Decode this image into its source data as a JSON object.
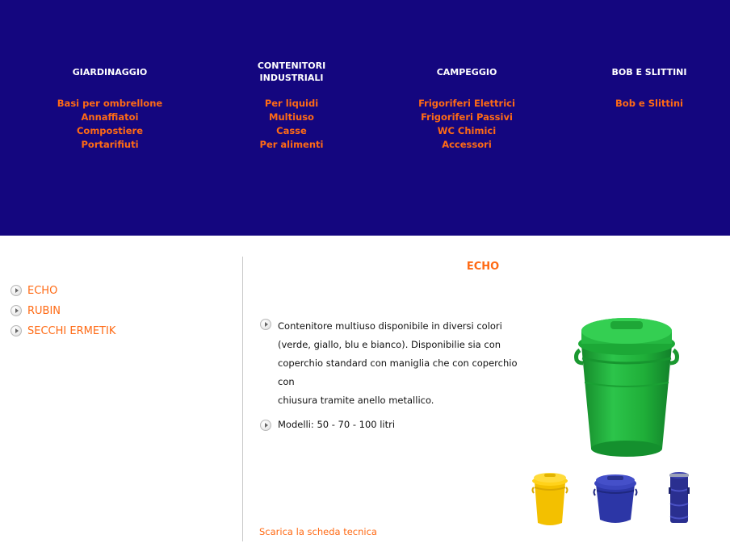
{
  "nav": [
    {
      "title": "GIARDINAGGIO",
      "links": [
        "Basi per ombrellone",
        "Annaffiatoi",
        "Compostiere",
        "Portarifiuti"
      ]
    },
    {
      "title": "CONTENITORI INDUSTRIALI",
      "title_lines": [
        "CONTENITORI",
        "INDUSTRIALI"
      ],
      "links": [
        "Per liquidi",
        "Multiuso",
        "Casse",
        "Per alimenti"
      ]
    },
    {
      "title": "CAMPEGGIO",
      "links": [
        "Frigoriferi Elettrici",
        "Frigoriferi Passivi",
        "WC Chimici",
        "Accessori"
      ]
    },
    {
      "title": "BOB E SLITTINI",
      "links": [
        "Bob e Slittini"
      ]
    }
  ],
  "sidebar": {
    "items": [
      "ECHO",
      "RUBIN",
      "SECCHI ERMETIK"
    ]
  },
  "product": {
    "title": "ECHO",
    "description": "Contenitore multiuso disponibile in diversi colori (verde, giallo, blu e bianco). Disponibilie sia con coperchio standard con maniglia che con coperchio con chiusura tramite anello metallico.",
    "description_lines": [
      "Contenitore multiuso disponibile in diversi colori",
      "(verde, giallo, blu e bianco). Disponibilie sia con",
      "coperchio standard con maniglia che con coperchio con",
      "chiusura tramite anello metallico."
    ],
    "models": "Modelli: 50 - 70 - 100 litri",
    "download_link": "Scarica la scheda tecnica"
  },
  "images": {
    "main": {
      "name": "green-bin",
      "color": "#20b43a"
    },
    "thumbs": [
      {
        "name": "yellow-bin",
        "color": "#f5c400"
      },
      {
        "name": "blue-bin",
        "color": "#2a35a8"
      },
      {
        "name": "blue-stacked-bins",
        "color": "#2a2f90"
      }
    ]
  },
  "colors": {
    "nav_bg": "#14067f",
    "accent": "#ff6a14",
    "text": "#111111",
    "divider": "#c8c8c8"
  }
}
